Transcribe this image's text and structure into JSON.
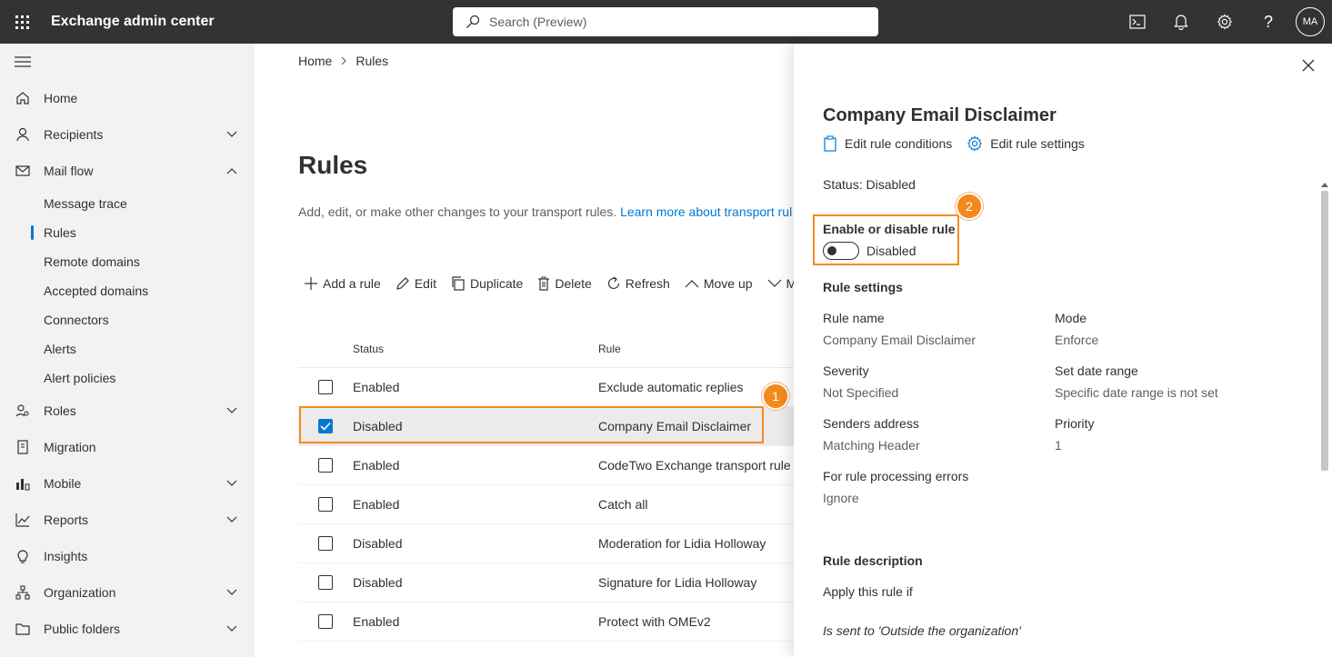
{
  "topbar": {
    "title": "Exchange admin center",
    "search_placeholder": "Search (Preview)",
    "avatar_initials": "MA",
    "help_glyph": "?"
  },
  "sidebar": {
    "items": [
      {
        "label": "Home"
      },
      {
        "label": "Recipients"
      },
      {
        "label": "Mail flow"
      },
      {
        "label": "Roles"
      },
      {
        "label": "Migration"
      },
      {
        "label": "Mobile"
      },
      {
        "label": "Reports"
      },
      {
        "label": "Insights"
      },
      {
        "label": "Organization"
      },
      {
        "label": "Public folders"
      }
    ],
    "mailflow_sub": [
      {
        "label": "Message trace"
      },
      {
        "label": "Rules"
      },
      {
        "label": "Remote domains"
      },
      {
        "label": "Accepted domains"
      },
      {
        "label": "Connectors"
      },
      {
        "label": "Alerts"
      },
      {
        "label": "Alert policies"
      }
    ]
  },
  "main": {
    "breadcrumb": {
      "home": "Home",
      "current": "Rules"
    },
    "title": "Rules",
    "description": "Add, edit, or make other changes to your transport rules.",
    "learn_more": "Learn more about transport rul",
    "toolbar": {
      "add": "Add a rule",
      "edit": "Edit",
      "duplicate": "Duplicate",
      "delete": "Delete",
      "refresh": "Refresh",
      "move_up": "Move up",
      "move_down_partial": "M"
    },
    "table": {
      "headers": {
        "status": "Status",
        "rule": "Rule"
      },
      "rows": [
        {
          "status": "Enabled",
          "rule": "Exclude automatic replies",
          "checked": false
        },
        {
          "status": "Disabled",
          "rule": "Company Email Disclaimer",
          "checked": true
        },
        {
          "status": "Enabled",
          "rule": "CodeTwo Exchange transport rule",
          "checked": false
        },
        {
          "status": "Enabled",
          "rule": "Catch all",
          "checked": false
        },
        {
          "status": "Disabled",
          "rule": "Moderation for Lidia Holloway",
          "checked": false
        },
        {
          "status": "Disabled",
          "rule": "Signature for Lidia Holloway",
          "checked": false
        },
        {
          "status": "Enabled",
          "rule": "Protect with OMEv2",
          "checked": false
        }
      ]
    }
  },
  "callouts": {
    "one": "1",
    "two": "2",
    "color": "#f38a1f"
  },
  "panel": {
    "title": "Company Email Disclaimer",
    "edit_conditions": "Edit rule conditions",
    "edit_settings": "Edit rule settings",
    "status": "Status: Disabled",
    "toggle_label": "Enable or disable rule",
    "toggle_state": "Disabled",
    "rule_settings_heading": "Rule settings",
    "fields": {
      "rule_name_label": "Rule name",
      "rule_name_value": "Company Email Disclaimer",
      "mode_label": "Mode",
      "mode_value": "Enforce",
      "severity_label": "Severity",
      "severity_value": "Not Specified",
      "date_range_label": "Set date range",
      "date_range_value": "Specific date range is not set",
      "senders_label": "Senders address",
      "senders_value": "Matching Header",
      "priority_label": "Priority",
      "priority_value": "1",
      "errors_label": "For rule processing errors",
      "errors_value": "Ignore"
    },
    "rule_description_heading": "Rule description",
    "apply_if": "Apply this rule if",
    "condition": "Is sent to 'Outside the organization'"
  },
  "colors": {
    "accent": "#0078d4",
    "topbar": "#333333",
    "sidebar": "#f3f2f1"
  }
}
